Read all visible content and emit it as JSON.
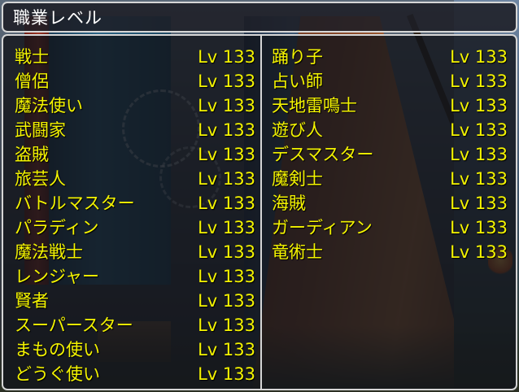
{
  "window_title": "職業レベル",
  "left_column": [
    {
      "name": "戦士",
      "level": "Lv 133"
    },
    {
      "name": "僧侶",
      "level": "Lv 133"
    },
    {
      "name": "魔法使い",
      "level": "Lv 133"
    },
    {
      "name": "武闘家",
      "level": "Lv 133"
    },
    {
      "name": "盗賊",
      "level": "Lv 133"
    },
    {
      "name": "旅芸人",
      "level": "Lv 133"
    },
    {
      "name": "バトルマスター",
      "level": "Lv 133"
    },
    {
      "name": "パラディン",
      "level": "Lv 133"
    },
    {
      "name": "魔法戦士",
      "level": "Lv 133"
    },
    {
      "name": "レンジャー",
      "level": "Lv 133"
    },
    {
      "name": "賢者",
      "level": "Lv 133"
    },
    {
      "name": "スーパースター",
      "level": "Lv 133"
    },
    {
      "name": "まもの使い",
      "level": "Lv 133"
    },
    {
      "name": "どうぐ使い",
      "level": "Lv 133"
    }
  ],
  "right_column": [
    {
      "name": "踊り子",
      "level": "Lv 133"
    },
    {
      "name": "占い師",
      "level": "Lv 133"
    },
    {
      "name": "天地雷鳴士",
      "level": "Lv 133"
    },
    {
      "name": "遊び人",
      "level": "Lv 133"
    },
    {
      "name": "デスマスター",
      "level": "Lv 133"
    },
    {
      "name": "魔剣士",
      "level": "Lv 133"
    },
    {
      "name": "海賊",
      "level": "Lv 133"
    },
    {
      "name": "ガーディアン",
      "level": "Lv 133"
    },
    {
      "name": "竜術士",
      "level": "Lv 133"
    }
  ],
  "colors": {
    "text": "#f4f400",
    "title_text": "#ffffff",
    "border": "#d6d6d6",
    "panel": "#12141a"
  }
}
